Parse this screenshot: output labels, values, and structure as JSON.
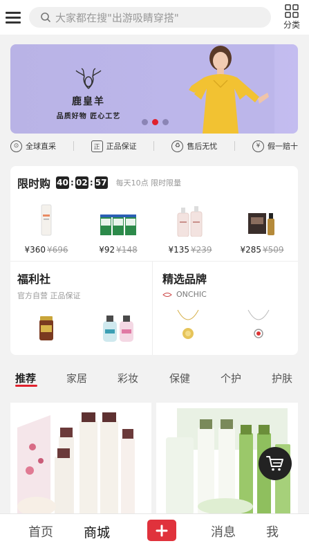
{
  "header": {
    "search_placeholder": "大家都在搜\"出游吸睛穿搭\"",
    "category_label": "分类"
  },
  "banner": {
    "brand_name": "鹿皇羊",
    "brand_slogan": "品质好物 匠心工艺",
    "dots": 3,
    "active_dot": 2,
    "bg_color": "#bcb6ea"
  },
  "guarantees": [
    {
      "icon": "globe-icon",
      "label": "全球直采"
    },
    {
      "icon": "genuine-icon",
      "label": "正品保证"
    },
    {
      "icon": "service-icon",
      "label": "售后无忧"
    },
    {
      "icon": "yuan-icon",
      "label": "假一赔十"
    }
  ],
  "flash_sale": {
    "title": "限时购",
    "countdown": {
      "h": "40",
      "m": "02",
      "s": "57"
    },
    "note": "每天10点 限时限量",
    "items": [
      {
        "price": "¥360",
        "old_price": "¥696"
      },
      {
        "price": "¥92",
        "old_price": "¥148"
      },
      {
        "price": "¥135",
        "old_price": "¥239"
      },
      {
        "price": "¥285",
        "old_price": "¥509"
      }
    ]
  },
  "welfare": {
    "title": "福利社",
    "subtitle": "官方自营 正品保证"
  },
  "brands": {
    "title": "精选品牌",
    "featured": "ONCHIC"
  },
  "tabs": [
    "推荐",
    "家居",
    "彩妆",
    "保健",
    "个护",
    "护肤"
  ],
  "active_tab": 0,
  "bottom_nav": {
    "home": "首页",
    "mall": "商城",
    "messages": "消息",
    "me": "我"
  },
  "accent_color": "#e0212d"
}
